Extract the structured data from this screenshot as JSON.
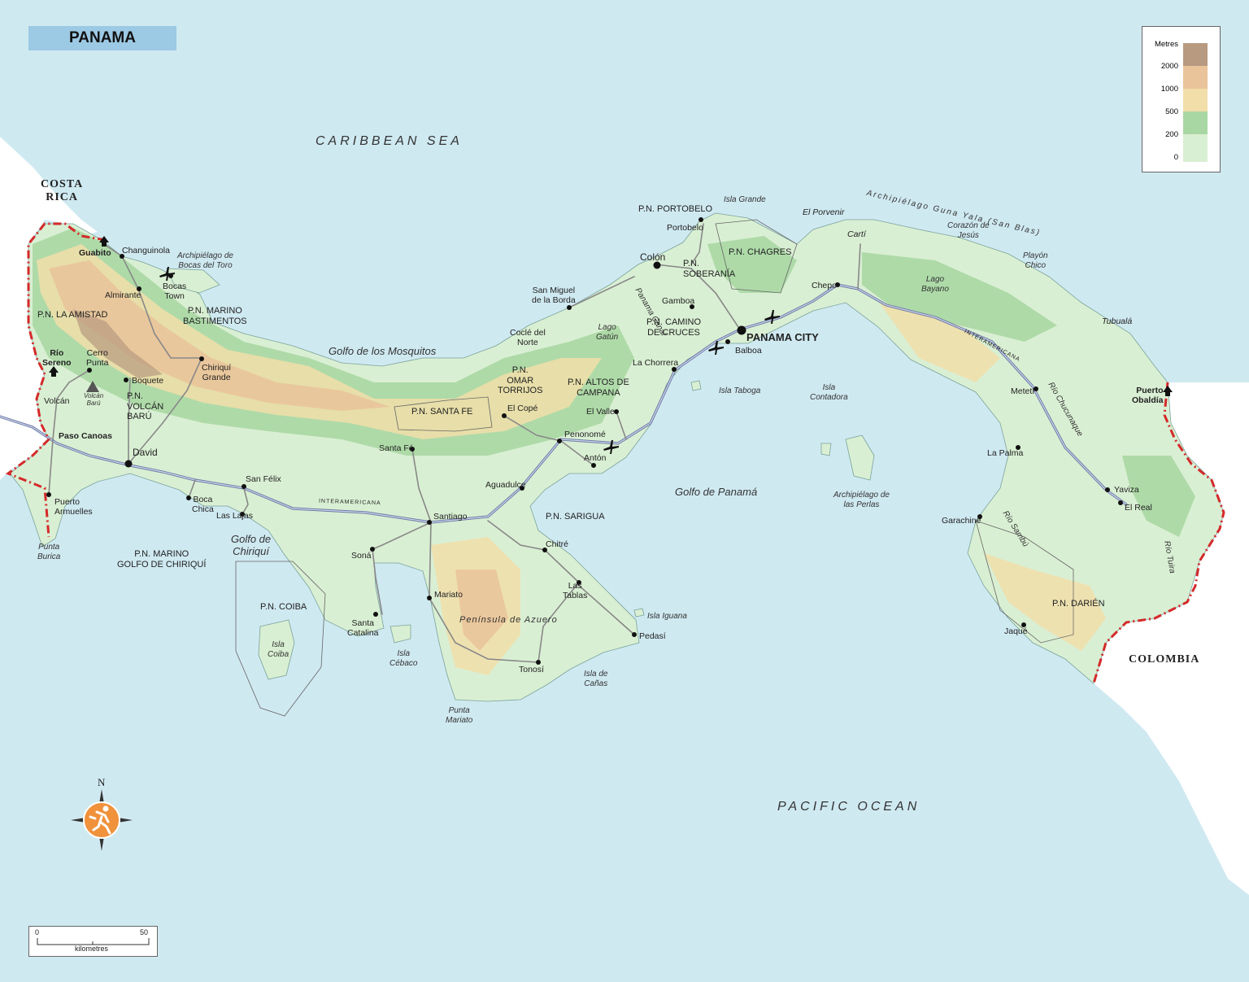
{
  "title": "PANAMA",
  "legend": {
    "heading": "Metres",
    "bands": [
      {
        "label": "2000",
        "color": "#b79a80"
      },
      {
        "label": "1000",
        "color": "#e9c39a"
      },
      {
        "label": "500",
        "color": "#f1dea9"
      },
      {
        "label": "200",
        "color": "#a9d7a3"
      },
      {
        "label": "0",
        "color": "#d9efd3"
      }
    ]
  },
  "scale_bar": {
    "start": "0",
    "end": "50",
    "unit": "kilometres"
  },
  "compass": {
    "north": "N"
  },
  "colors": {
    "sea": "#cfe9f1",
    "lowland": "#d9efd3",
    "border": "#d42a2a",
    "road": "#6c7aa6",
    "foreign_land": "#ffffff"
  },
  "water_bodies": {
    "caribbean": "CARIBBEAN SEA",
    "pacific": "PACIFIC OCEAN",
    "mosquitos": "Golfo de los Mosquitos",
    "panama_gulf": "Golfo de Panamá",
    "chiriqui": "Golfo de\nChiriquí"
  },
  "countries": {
    "costa_rica": "COSTA\nRICA",
    "colombia": "COLOMBIA"
  },
  "road_labels": {
    "west": "INTERAMERICANA",
    "east": "INTERAMERICANA"
  },
  "capital": "PANAMA CITY",
  "towns": {
    "guabito": "Guabito",
    "changuinola": "Changuinola",
    "almirante": "Almirante",
    "bocas_town": "Bocas\nTown",
    "rio_sereno": "Río\nSereno",
    "cerro_punta": "Cerro\nPunta",
    "boquete": "Boquete",
    "volcan": "Volcán",
    "paso_canoas": "Paso Canoas",
    "david": "David",
    "chiriqui_grande": "Chiriquí\nGrande",
    "puerto_armuelles": "Puerto\nArmuelles",
    "boca_chica": "Boca\nChica",
    "las_lajas": "Las Lajas",
    "san_felix": "San Félix",
    "santa_fe": "Santa Fé",
    "santiago": "Santiago",
    "sona": "Soná",
    "santa_catalina": "Santa\nCatalina",
    "mariato": "Mariato",
    "tonosi": "Tonosí",
    "pedasi": "Pedasí",
    "las_tablas": "Las\nTablas",
    "chitre": "Chitré",
    "aguadulce": "Aguadulce",
    "penonome": "Penonomé",
    "el_cope": "El Copé",
    "el_valle": "El Valle",
    "anton": "Antón",
    "san_miguel": "San Miguel\nde la Borda",
    "cocle_del_norte": "Coclé del\nNorte",
    "la_chorrera": "La Chorrera",
    "balboa": "Balboa",
    "gamboa": "Gamboa",
    "colon": "Colón",
    "portobelo": "Portobelo",
    "chepo": "Chepo",
    "carti": "Cartí",
    "el_porvenir": "El Porvenir",
    "meteti": "Metetí",
    "la_palma": "La Palma",
    "yaviza": "Yaviza",
    "el_real": "El Real",
    "garachine": "Garachiné",
    "jaque": "Jaqué",
    "puerto_obaldia": "Puerto\nObaldía",
    "tubuala": "Tubualá"
  },
  "parks": {
    "amistad": "P.N. LA AMISTAD",
    "bastimentos": "P.N. MARINO\nBASTIMENTOS",
    "volcan_baru": "P.N.\nVOLCÁN\nBARÚ",
    "chiriqui_marino": "P.N. MARINO\nGOLFO DE CHIRIQUÍ",
    "coiba": "P.N. COIBA",
    "santa_fe": "P.N. SANTA FE",
    "omar_torrijos": "P.N.\nOMAR\nTORRIJOS",
    "altos_campana": "P.N. ALTOS DE\nCAMPANA",
    "sarigua": "P.N. SARIGUA",
    "portobelo": "P.N. PORTOBELO",
    "chagres": "P.N. CHAGRES",
    "soberania": "P.N.\nSOBERANÍA",
    "camino_cruces": "P.N. CAMINO\nDE CRUCES",
    "darien": "P.N. DARIÉN"
  },
  "features": {
    "volcan_baru_peak": "Volcán\nBarú",
    "bocas_archipelago": "Archipiélago de\nBocas del Toro",
    "isla_coiba": "Isla\nCoiba",
    "isla_cebaco": "Isla\nCébaco",
    "punta_mariato": "Punta\nMariato",
    "punta_burica": "Punta\nBurica",
    "azuero": "Península de Azuero",
    "isla_iguana": "Isla Iguana",
    "isla_canas": "Isla de\nCañas",
    "lago_gatun": "Lago\nGatún",
    "panama_canal": "Panama Canal",
    "isla_taboga": "Isla Taboga",
    "isla_contadora": "Isla\nContadora",
    "perlas": "Archipiélago de\nlas Perlas",
    "isla_grande": "Isla Grande",
    "guna_yala": "Archipiélago Guna Yala (San Blas)",
    "corazon_jesus": "Corazón de\nJesús",
    "playon_chico": "Playón\nChico",
    "lago_bayano": "Lago\nBayano",
    "rio_chucunaque": "Río Chucunaque",
    "rio_sambu": "Río Sambú",
    "rio_tuira": "Río Tuira"
  }
}
